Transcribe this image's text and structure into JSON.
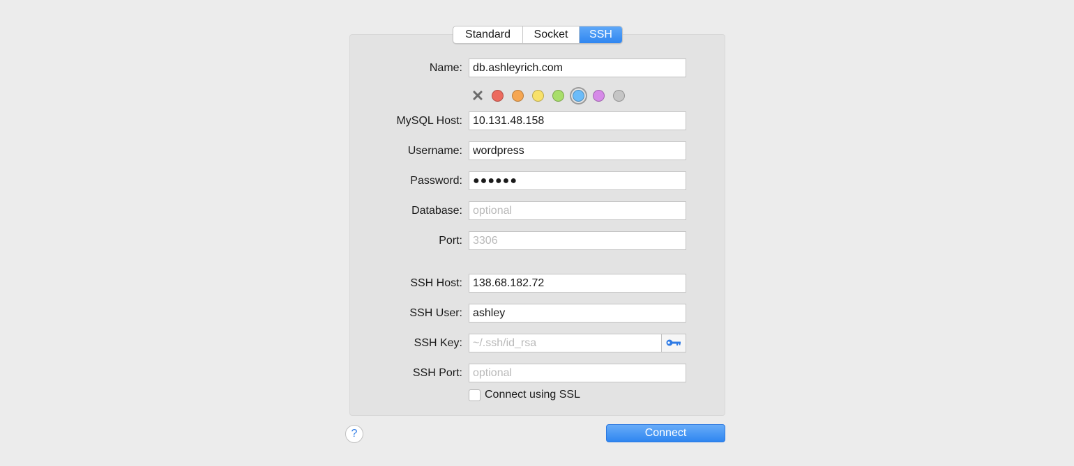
{
  "tabs": [
    {
      "label": "Standard",
      "active": false
    },
    {
      "label": "Socket",
      "active": false
    },
    {
      "label": "SSH",
      "active": true
    }
  ],
  "form": {
    "name": {
      "label": "Name:",
      "value": "db.ashleyrich.com"
    },
    "color_labels": {
      "clear_icon": "x-icon",
      "colors": [
        "#ec6a5e",
        "#f5a652",
        "#f8e16a",
        "#a8de6a",
        "#6bbcf9",
        "#d68ae8",
        "#c5c5c5"
      ],
      "selected_index": 4
    },
    "mysql_host": {
      "label": "MySQL Host:",
      "value": "10.131.48.158"
    },
    "username": {
      "label": "Username:",
      "value": "wordpress"
    },
    "password": {
      "label": "Password:",
      "value": "●●●●●●"
    },
    "database": {
      "label": "Database:",
      "placeholder": "optional"
    },
    "port": {
      "label": "Port:",
      "placeholder": "3306"
    },
    "ssh_host": {
      "label": "SSH Host:",
      "value": "138.68.182.72"
    },
    "ssh_user": {
      "label": "SSH User:",
      "value": "ashley"
    },
    "ssh_key": {
      "label": "SSH Key:",
      "placeholder": "~/.ssh/id_rsa",
      "button_icon": "key-icon"
    },
    "ssh_port": {
      "label": "SSH Port:",
      "placeholder": "optional"
    },
    "ssl": {
      "label": "Connect using SSL",
      "checked": false
    }
  },
  "footer": {
    "help_label": "?",
    "connect_label": "Connect"
  },
  "colors": {
    "accent": "#2f86f0",
    "panel": "#e3e3e3",
    "background": "#ececec"
  }
}
